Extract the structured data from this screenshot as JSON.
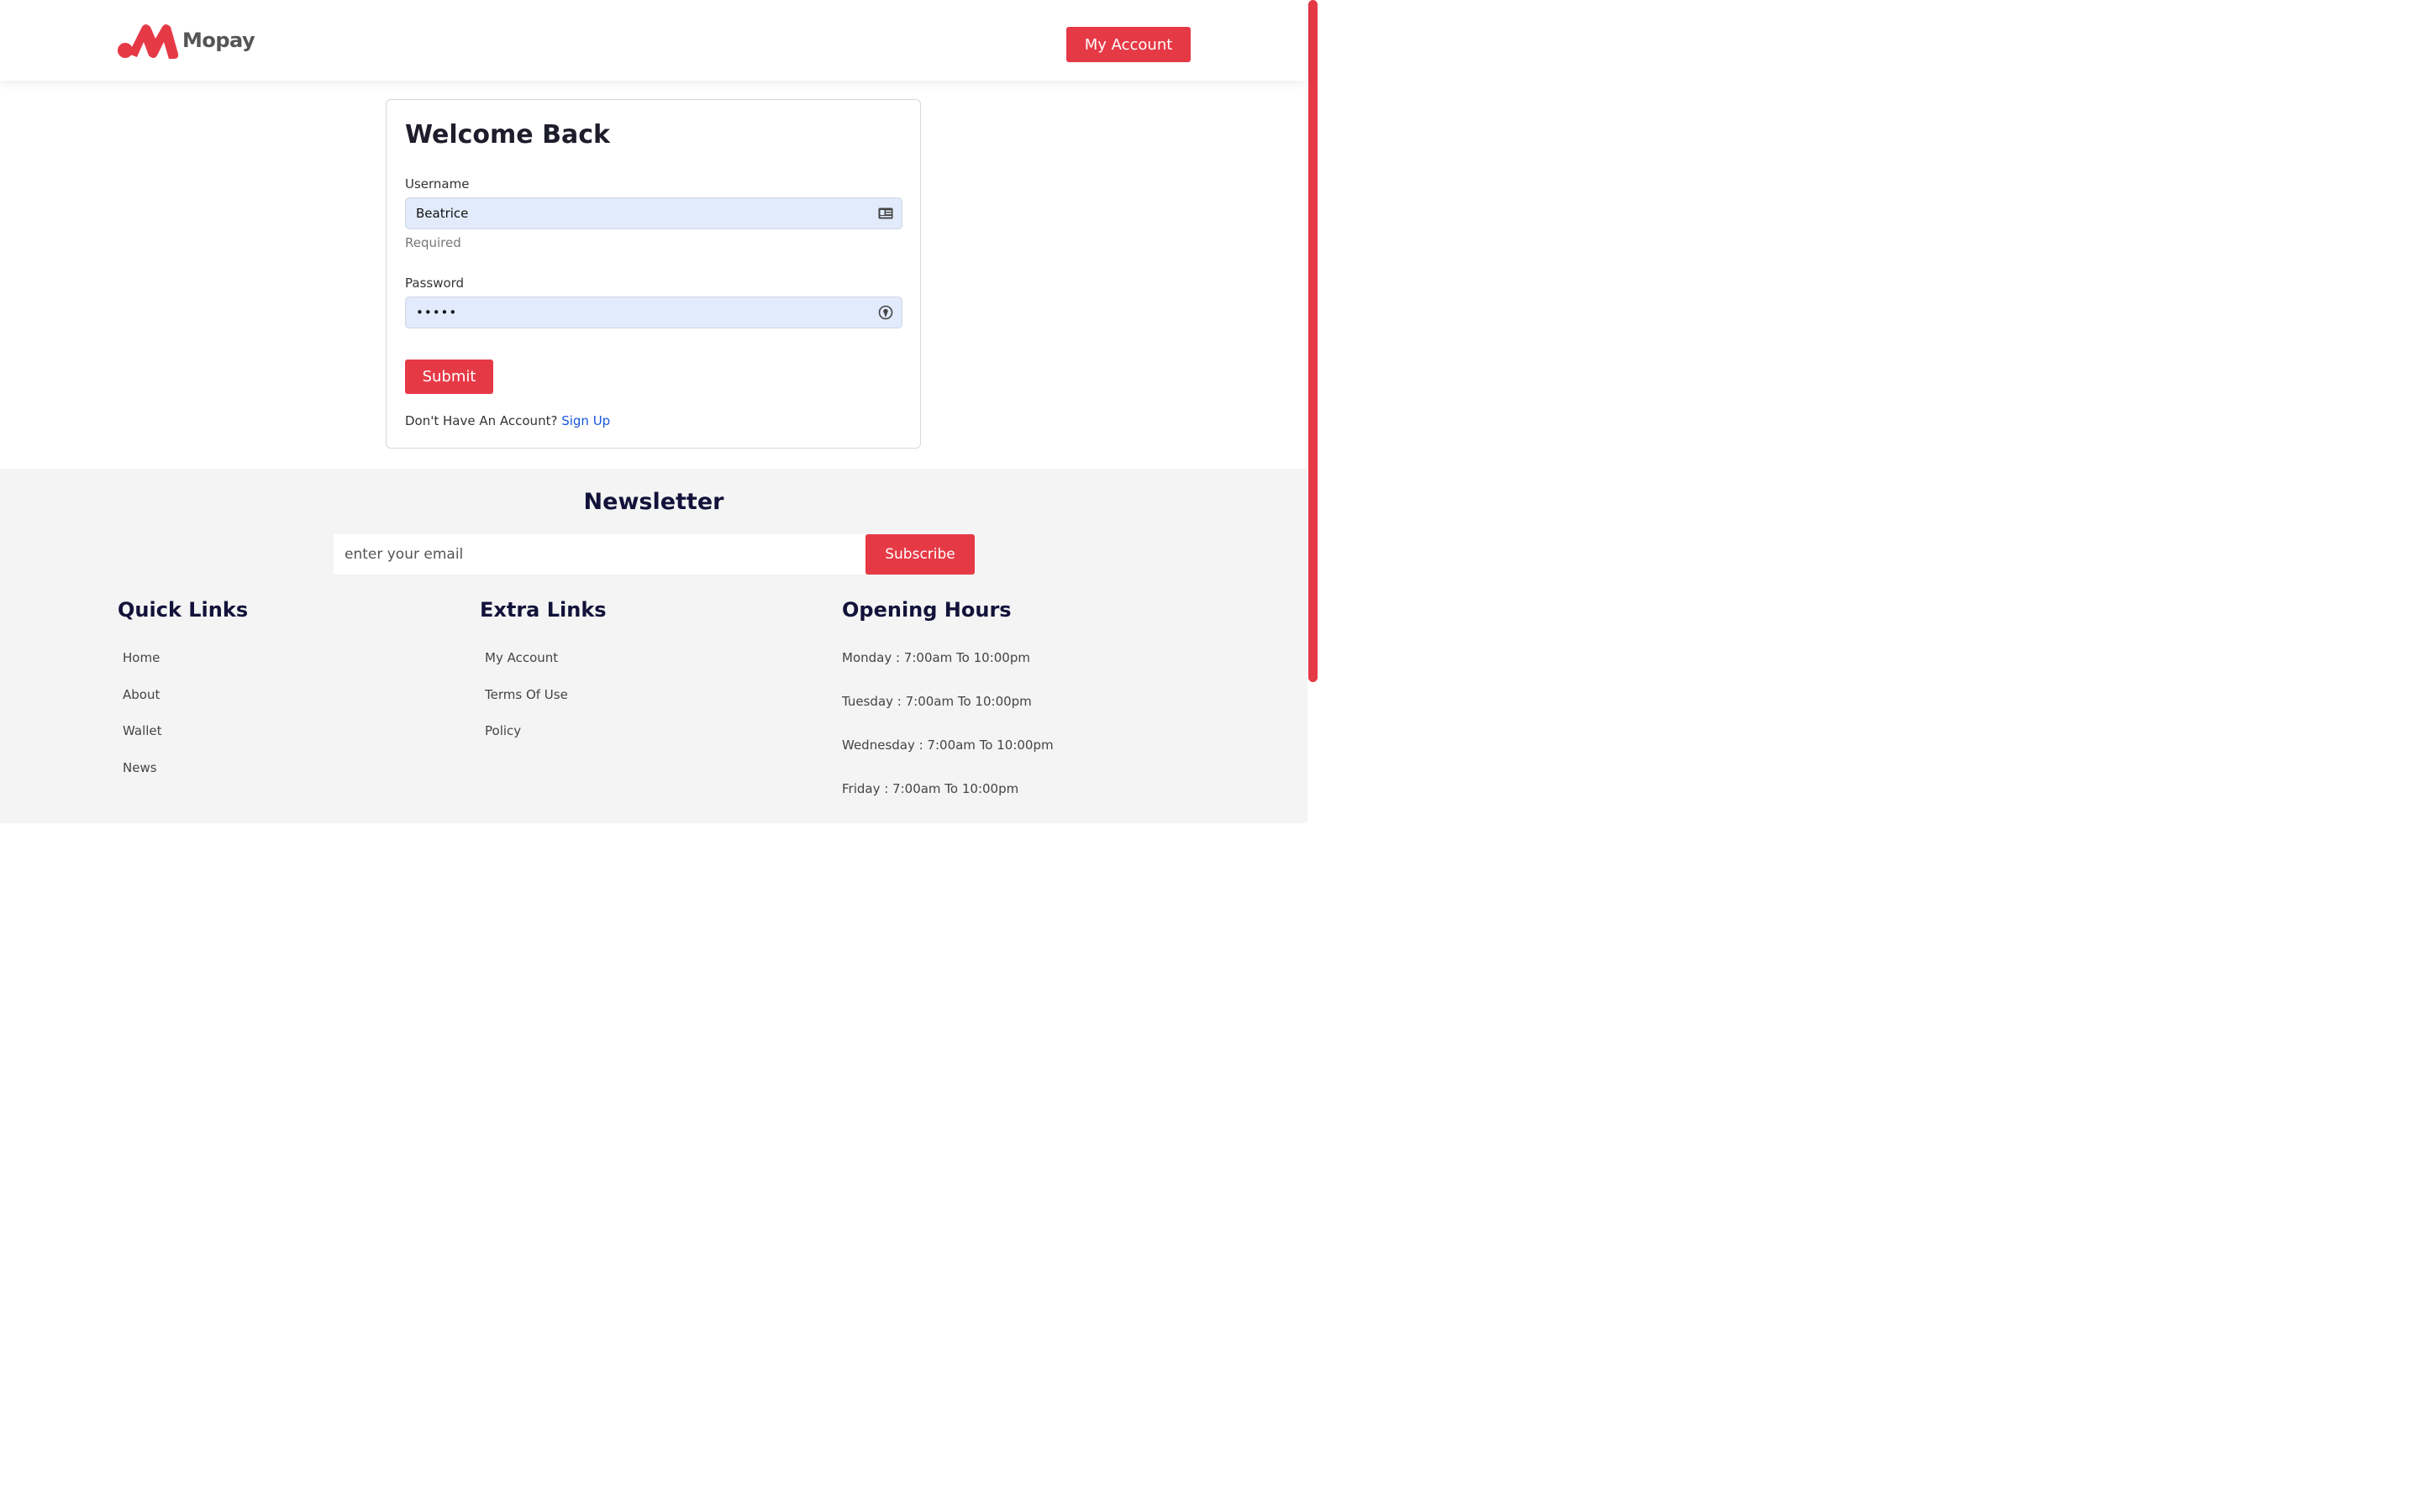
{
  "brand": {
    "name": "Mopay",
    "accent": "#e63946"
  },
  "header": {
    "account_button": "My Account"
  },
  "login": {
    "title": "Welcome Back",
    "username_label": "Username",
    "username_value": "Beatrice",
    "username_icon": "id-card-icon",
    "username_hint": "Required",
    "password_label": "Password",
    "password_value": "•••••",
    "password_icon": "password-key-icon",
    "submit_label": "Submit",
    "signup_prompt": "Don't Have An Account?",
    "signup_link": "Sign Up"
  },
  "newsletter": {
    "title": "Newsletter",
    "email_placeholder": "enter your email",
    "subscribe_label": "Subscribe"
  },
  "footer": {
    "quick_links": {
      "title": "Quick Links",
      "items": [
        "Home",
        "About",
        "Wallet",
        "News"
      ]
    },
    "extra_links": {
      "title": "Extra Links",
      "items": [
        "My Account",
        "Terms Of Use",
        "Policy"
      ]
    },
    "opening_hours": {
      "title": "Opening Hours",
      "items": [
        "Monday : 7:00am To 10:00pm",
        "Tuesday : 7:00am To 10:00pm",
        "Wednesday : 7:00am To 10:00pm",
        "Friday : 7:00am To 10:00pm"
      ]
    }
  }
}
